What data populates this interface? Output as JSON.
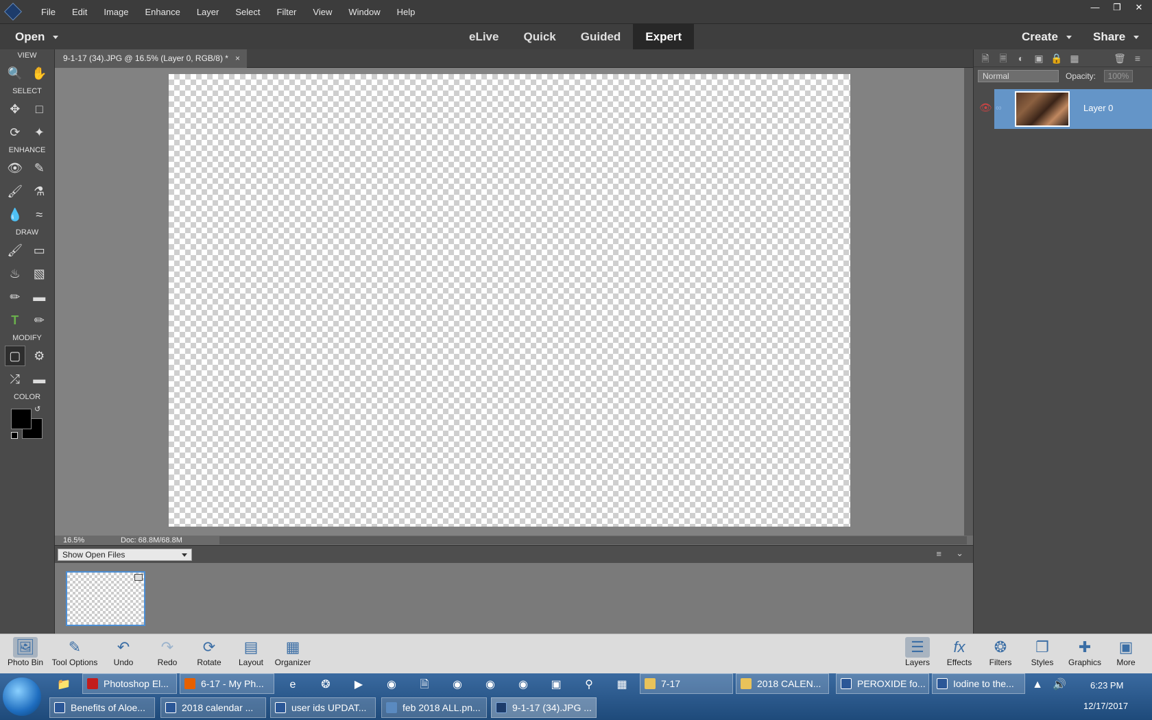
{
  "menubar": {
    "items": [
      "File",
      "Edit",
      "Image",
      "Enhance",
      "Layer",
      "Select",
      "Filter",
      "View",
      "Window",
      "Help"
    ]
  },
  "modebar": {
    "open_label": "Open",
    "tabs": [
      "eLive",
      "Quick",
      "Guided",
      "Expert"
    ],
    "active_tab": "Expert",
    "create_label": "Create",
    "share_label": "Share"
  },
  "tools": {
    "sections": [
      "VIEW",
      "SELECT",
      "ENHANCE",
      "DRAW",
      "MODIFY",
      "COLOR"
    ]
  },
  "document": {
    "tab_title": "9-1-17 (34).JPG @ 16.5% (Layer 0, RGB/8) *",
    "zoom": "16.5%",
    "doc_size": "Doc: 68.8M/68.8M"
  },
  "photo_bin": {
    "dropdown_value": "Show Open Files"
  },
  "layers_panel": {
    "blend_mode": "Normal",
    "opacity_label": "Opacity:",
    "opacity_value": "100%",
    "layer_name": "Layer 0"
  },
  "bottom_bar": {
    "left": [
      "Photo Bin",
      "Tool Options",
      "Undo",
      "Redo",
      "Rotate",
      "Layout",
      "Organizer"
    ],
    "right": [
      "Layers",
      "Effects",
      "Filters",
      "Styles",
      "Graphics",
      "More"
    ]
  },
  "taskbar": {
    "row1": [
      "Photoshop El...",
      "6-17 - My Ph...",
      "7-17",
      "2018 CALEN...",
      "PEROXIDE fo...",
      "Iodine to the..."
    ],
    "row2": [
      "Benefits of Aloe...",
      "2018 calendar ...",
      "user ids UPDAT...",
      "feb 2018 ALL.pn...",
      "9-1-17 (34).JPG ..."
    ],
    "time": "6:23 PM",
    "date": "12/17/2017"
  },
  "colors": {
    "accent": "#4c8fd6",
    "layer_highlight": "#6495c8"
  }
}
